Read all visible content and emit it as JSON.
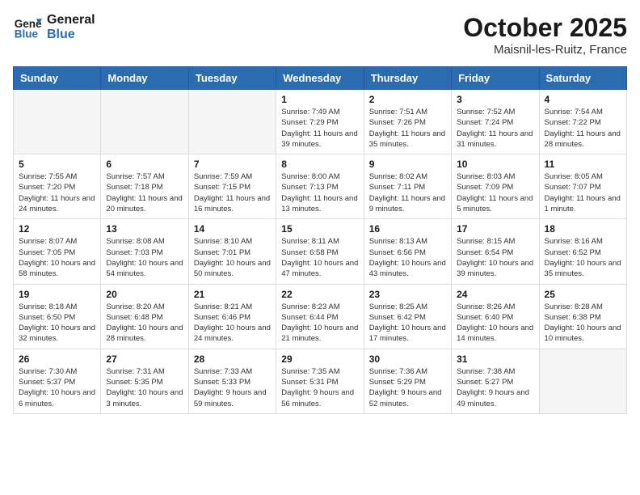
{
  "header": {
    "logo_line1": "General",
    "logo_line2": "Blue",
    "month": "October 2025",
    "location": "Maisnil-les-Ruitz, France"
  },
  "days_of_week": [
    "Sunday",
    "Monday",
    "Tuesday",
    "Wednesday",
    "Thursday",
    "Friday",
    "Saturday"
  ],
  "weeks": [
    [
      {
        "num": "",
        "info": ""
      },
      {
        "num": "",
        "info": ""
      },
      {
        "num": "",
        "info": ""
      },
      {
        "num": "1",
        "info": "Sunrise: 7:49 AM\nSunset: 7:29 PM\nDaylight: 11 hours and 39 minutes."
      },
      {
        "num": "2",
        "info": "Sunrise: 7:51 AM\nSunset: 7:26 PM\nDaylight: 11 hours and 35 minutes."
      },
      {
        "num": "3",
        "info": "Sunrise: 7:52 AM\nSunset: 7:24 PM\nDaylight: 11 hours and 31 minutes."
      },
      {
        "num": "4",
        "info": "Sunrise: 7:54 AM\nSunset: 7:22 PM\nDaylight: 11 hours and 28 minutes."
      }
    ],
    [
      {
        "num": "5",
        "info": "Sunrise: 7:55 AM\nSunset: 7:20 PM\nDaylight: 11 hours and 24 minutes."
      },
      {
        "num": "6",
        "info": "Sunrise: 7:57 AM\nSunset: 7:18 PM\nDaylight: 11 hours and 20 minutes."
      },
      {
        "num": "7",
        "info": "Sunrise: 7:59 AM\nSunset: 7:15 PM\nDaylight: 11 hours and 16 minutes."
      },
      {
        "num": "8",
        "info": "Sunrise: 8:00 AM\nSunset: 7:13 PM\nDaylight: 11 hours and 13 minutes."
      },
      {
        "num": "9",
        "info": "Sunrise: 8:02 AM\nSunset: 7:11 PM\nDaylight: 11 hours and 9 minutes."
      },
      {
        "num": "10",
        "info": "Sunrise: 8:03 AM\nSunset: 7:09 PM\nDaylight: 11 hours and 5 minutes."
      },
      {
        "num": "11",
        "info": "Sunrise: 8:05 AM\nSunset: 7:07 PM\nDaylight: 11 hours and 1 minute."
      }
    ],
    [
      {
        "num": "12",
        "info": "Sunrise: 8:07 AM\nSunset: 7:05 PM\nDaylight: 10 hours and 58 minutes."
      },
      {
        "num": "13",
        "info": "Sunrise: 8:08 AM\nSunset: 7:03 PM\nDaylight: 10 hours and 54 minutes."
      },
      {
        "num": "14",
        "info": "Sunrise: 8:10 AM\nSunset: 7:01 PM\nDaylight: 10 hours and 50 minutes."
      },
      {
        "num": "15",
        "info": "Sunrise: 8:11 AM\nSunset: 6:58 PM\nDaylight: 10 hours and 47 minutes."
      },
      {
        "num": "16",
        "info": "Sunrise: 8:13 AM\nSunset: 6:56 PM\nDaylight: 10 hours and 43 minutes."
      },
      {
        "num": "17",
        "info": "Sunrise: 8:15 AM\nSunset: 6:54 PM\nDaylight: 10 hours and 39 minutes."
      },
      {
        "num": "18",
        "info": "Sunrise: 8:16 AM\nSunset: 6:52 PM\nDaylight: 10 hours and 35 minutes."
      }
    ],
    [
      {
        "num": "19",
        "info": "Sunrise: 8:18 AM\nSunset: 6:50 PM\nDaylight: 10 hours and 32 minutes."
      },
      {
        "num": "20",
        "info": "Sunrise: 8:20 AM\nSunset: 6:48 PM\nDaylight: 10 hours and 28 minutes."
      },
      {
        "num": "21",
        "info": "Sunrise: 8:21 AM\nSunset: 6:46 PM\nDaylight: 10 hours and 24 minutes."
      },
      {
        "num": "22",
        "info": "Sunrise: 8:23 AM\nSunset: 6:44 PM\nDaylight: 10 hours and 21 minutes."
      },
      {
        "num": "23",
        "info": "Sunrise: 8:25 AM\nSunset: 6:42 PM\nDaylight: 10 hours and 17 minutes."
      },
      {
        "num": "24",
        "info": "Sunrise: 8:26 AM\nSunset: 6:40 PM\nDaylight: 10 hours and 14 minutes."
      },
      {
        "num": "25",
        "info": "Sunrise: 8:28 AM\nSunset: 6:38 PM\nDaylight: 10 hours and 10 minutes."
      }
    ],
    [
      {
        "num": "26",
        "info": "Sunrise: 7:30 AM\nSunset: 5:37 PM\nDaylight: 10 hours and 6 minutes."
      },
      {
        "num": "27",
        "info": "Sunrise: 7:31 AM\nSunset: 5:35 PM\nDaylight: 10 hours and 3 minutes."
      },
      {
        "num": "28",
        "info": "Sunrise: 7:33 AM\nSunset: 5:33 PM\nDaylight: 9 hours and 59 minutes."
      },
      {
        "num": "29",
        "info": "Sunrise: 7:35 AM\nSunset: 5:31 PM\nDaylight: 9 hours and 56 minutes."
      },
      {
        "num": "30",
        "info": "Sunrise: 7:36 AM\nSunset: 5:29 PM\nDaylight: 9 hours and 52 minutes."
      },
      {
        "num": "31",
        "info": "Sunrise: 7:38 AM\nSunset: 5:27 PM\nDaylight: 9 hours and 49 minutes."
      },
      {
        "num": "",
        "info": ""
      }
    ]
  ]
}
